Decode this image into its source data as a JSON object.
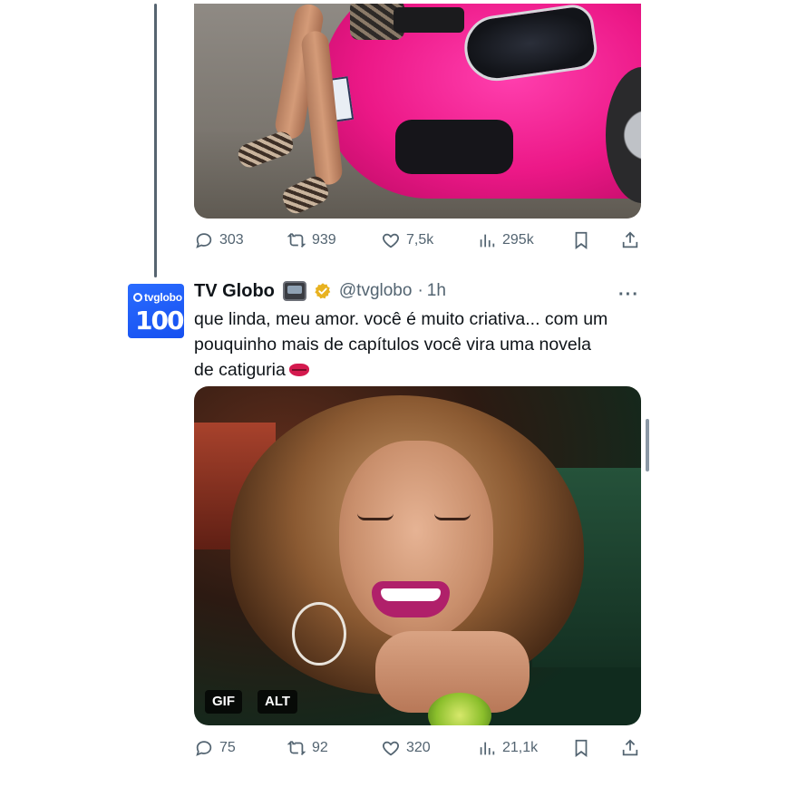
{
  "tweet1": {
    "media": {
      "description_icon": "image-icon"
    },
    "actions": {
      "replies": "303",
      "retweets": "939",
      "likes": "7,5k",
      "views": "295k"
    }
  },
  "tweet2": {
    "display_name": "TV Globo",
    "name_emoji": "television-emoji",
    "verified": true,
    "handle": "@tvglobo",
    "separator": "·",
    "time": "1h",
    "more_label": "···",
    "avatar": {
      "brand_text": "tvglobo",
      "number_text": "100"
    },
    "text_lines": [
      "que linda, meu amor. você é muito criativa... com um",
      "pouquinho mais de capítulos você vira uma novela",
      "de catiguria"
    ],
    "text_emoji": "kiss-mark-emoji",
    "media": {
      "gif_badge": "GIF",
      "alt_badge": "ALT"
    },
    "actions": {
      "replies": "75",
      "retweets": "92",
      "likes": "320",
      "views": "21,1k"
    }
  },
  "colors": {
    "text_primary": "#0f1419",
    "text_secondary": "#536471",
    "verified_gold": "#e8b220",
    "avatar_blue": "#1e5eff"
  }
}
